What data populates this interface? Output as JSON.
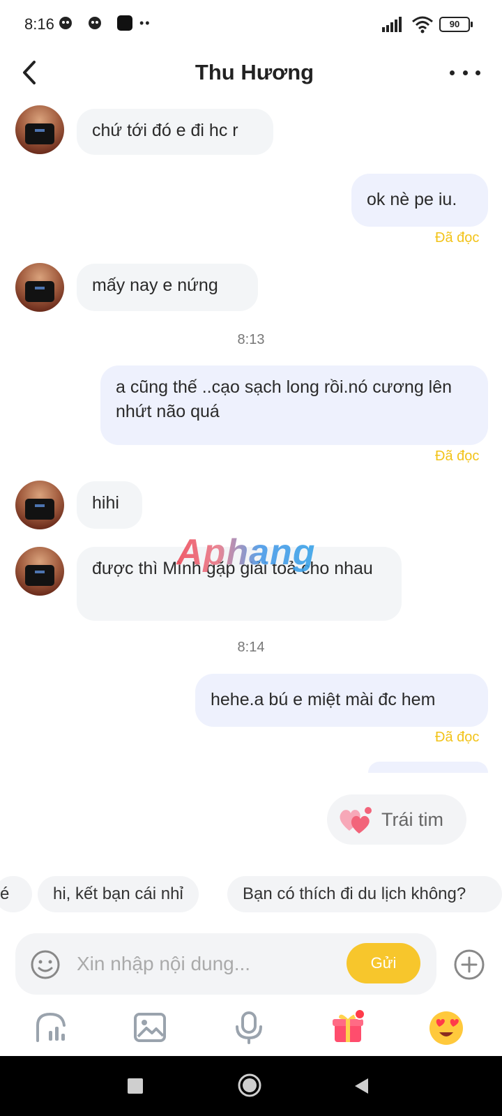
{
  "status_bar": {
    "time": "8:16",
    "battery": "90"
  },
  "header": {
    "title": "Thu Hương"
  },
  "messages": [
    {
      "side": "in",
      "text": "chứ tới đó e đi hc r"
    },
    {
      "side": "out",
      "text": "ok nè pe iu.",
      "status": "Đã đọc"
    },
    {
      "side": "in",
      "text": "mấy nay e nứng"
    },
    {
      "side": "time",
      "text": "8:13"
    },
    {
      "side": "out",
      "text": "a cũng thế ..cạo sạch long rồi.nó cương lên nhứt não quá",
      "status": "Đã đọc"
    },
    {
      "side": "in",
      "text": "hihi"
    },
    {
      "side": "in",
      "text": "được thì Mình gặp giải toả cho nhau"
    },
    {
      "side": "time",
      "text": "8:14"
    },
    {
      "side": "out",
      "text": "hehe.a bú e miệt mài đc hem",
      "status": "Đã đọc"
    }
  ],
  "watermark": "Aphang",
  "suggestions": {
    "heart_label": "Trái tim",
    "chips": [
      "é",
      "hi, kết bạn cái nhỉ",
      "Bạn có thích đi du lịch không?"
    ]
  },
  "input": {
    "placeholder": "Xin nhập nội dung...",
    "send_label": "Gửi"
  },
  "toolbar": {
    "icons": [
      "stats-icon",
      "image-icon",
      "microphone-icon",
      "gift-icon",
      "emoji-icon"
    ]
  },
  "colors": {
    "accent": "#f7c62c",
    "read_status": "#f2c319",
    "bubble_out": "#eef1fd",
    "bubble_in": "#f3f5f7"
  }
}
